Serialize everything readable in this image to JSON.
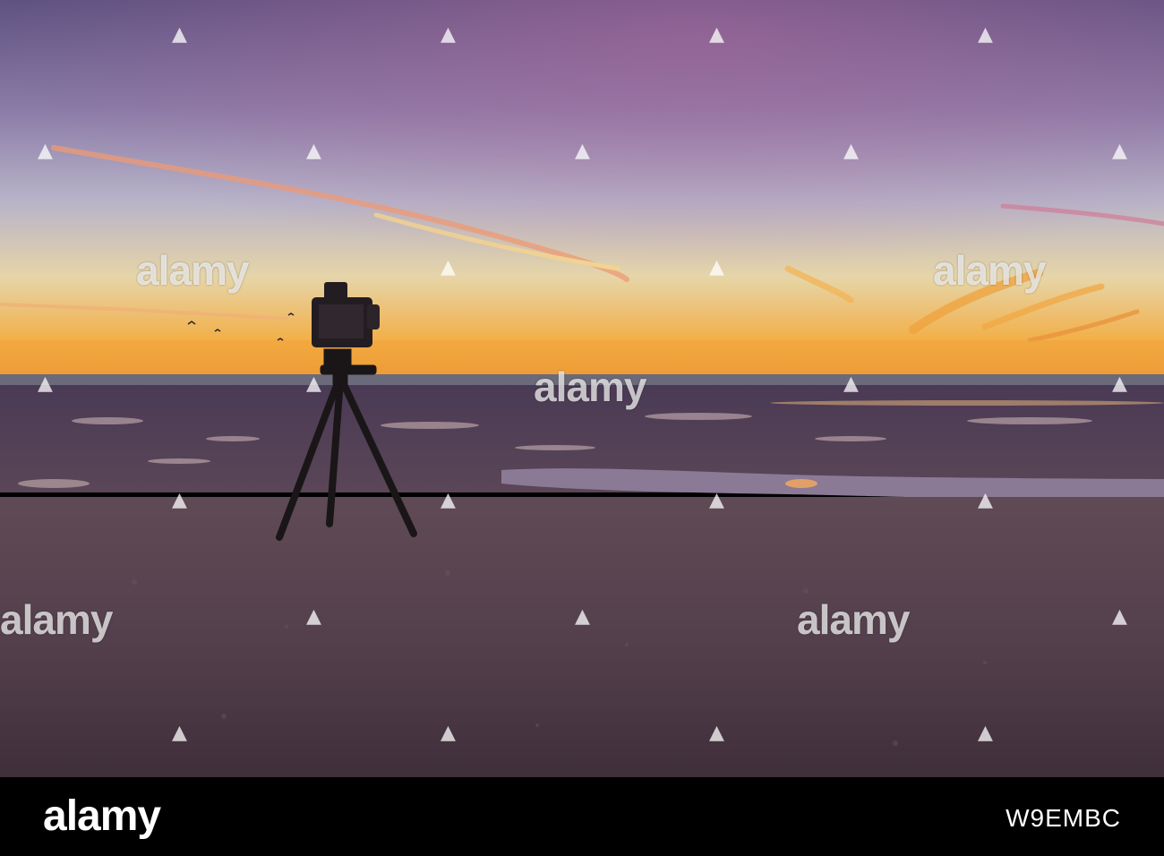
{
  "watermark": {
    "brand": "alamy",
    "mark_glyph": "▲"
  },
  "footer": {
    "brand": "alamy",
    "image_id": "W9EMBC"
  },
  "colors": {
    "sky_top": "#5e5281",
    "sky_mid": "#9c7fa8",
    "horizon_glow": "#f2a23a",
    "sand": "#5a4550",
    "tripod": "#1a1618"
  }
}
